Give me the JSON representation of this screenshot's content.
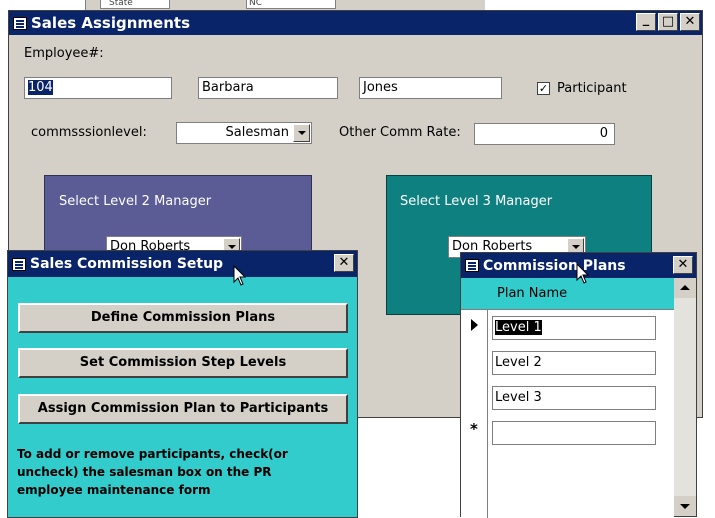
{
  "background_window": {
    "fragment_left": "State",
    "fragment_right": "NC"
  },
  "sales_assignments": {
    "title": "Sales Assignments",
    "employee_label": "Employee#:",
    "employee_number": "104",
    "first_name": "Barbara",
    "last_name": "Jones",
    "participant_label": "Participant",
    "participant_checked": true,
    "level_label": "commsssionlevel:",
    "level_value": "Salesman",
    "other_rate_label": "Other Comm Rate:",
    "other_rate_value": "0",
    "level2_label": "Select Level 2 Manager",
    "level2_value": "Don Roberts",
    "level3_label": "Select Level 3 Manager",
    "level3_value": "Don Roberts",
    "window_buttons": {
      "minimize": "_",
      "maximize": "□",
      "close": "✕"
    }
  },
  "commission_setup": {
    "title": "Sales Commission Setup",
    "buttons": [
      "Define Commission Plans",
      "Set Commission Step Levels",
      "Assign Commission Plan to Participants"
    ],
    "note": "To add or remove participants, check(or uncheck) the salesman box on the PR employee maintenance form",
    "close": "✕"
  },
  "commission_plans": {
    "title": "Commission Plans",
    "column_header": "Plan Name",
    "rows": [
      "Level 1",
      "Level 2",
      "Level 3"
    ],
    "new_row_marker": "*",
    "close": "✕"
  },
  "colors": {
    "titlebar": "#0a246a",
    "form_gray": "#d4d0c8",
    "purple_panel": "#5b5b96",
    "teal_panel": "#0f8080",
    "cyan_form": "#33cccc"
  }
}
